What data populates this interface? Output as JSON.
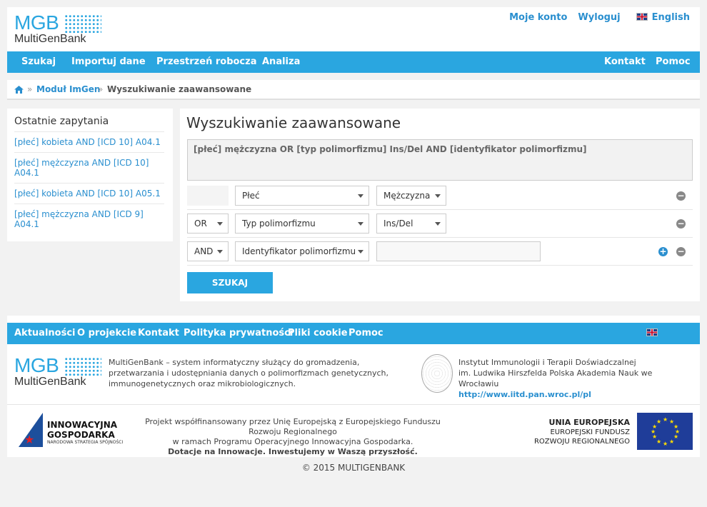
{
  "header": {
    "logo_short": "MGB",
    "logo_full": "MultiGenBank",
    "links": [
      "Moje konto",
      "Wyloguj"
    ],
    "language": "English"
  },
  "nav": {
    "left": [
      "Szukaj",
      "Importuj dane",
      "Przestrzeń robocza",
      "Analiza"
    ],
    "right": [
      "Kontakt",
      "Pomoc"
    ]
  },
  "breadcrumb": {
    "sep": "»",
    "items": [
      "Moduł ImGen",
      "Wyszukiwanie zaawansowane"
    ]
  },
  "sidebar": {
    "title": "Ostatnie zapytania",
    "items": [
      "[płeć] kobieta AND [ICD 10] A04.1",
      "[płeć] mężczyzna AND [ICD 10] A04.1",
      "[płeć] kobieta AND [ICD 10] A05.1",
      "[płeć] mężczyzna AND [ICD 9] A04.1"
    ]
  },
  "search": {
    "title": "Wyszukiwanie zaawansowane",
    "query": "[płeć] mężczyzna OR [typ polimorfizmu] Ins/Del AND [identyfikator polimorfizmu]",
    "rows": [
      {
        "op": "",
        "field": "Płeć",
        "value": "Mężczyzna"
      },
      {
        "op": "OR",
        "field": "Typ polimorfizmu",
        "value": "Ins/Del"
      },
      {
        "op": "AND",
        "field": "Identyfikator polimorfizmu",
        "value": ""
      }
    ],
    "button": "SZUKAJ",
    "minus": "−",
    "plus": "+"
  },
  "footer": {
    "nav": [
      "Aktualności",
      "O projekcie",
      "Kontakt",
      "Polityka prywatności",
      "Pliki cookie",
      "Pomoc"
    ],
    "language": "English",
    "desc": "MultiGenBank – system informatyczny służący do gromadzenia, przetwarzania i udostępniania danych o polimorfizmach genetycznych, immunogenetycznych oraz mikrobiologicznych.",
    "inst_line1": "Instytut Immunologii i Terapii Doświadczalnej",
    "inst_line2": "im. Ludwika Hirszfelda Polska Akademia Nauk we Wrocławiu",
    "inst_url": "http://www.iitd.pan.wroc.pl/pl",
    "ig_line1": "INNOWACYJNA",
    "ig_line2": "GOSPODARKA",
    "ig_line3": "NARODOWA STRATEGIA SPÓJNOŚCI",
    "proj_line1": "Projekt współfinansowany przez Unię Europejską z Europejskiego Funduszu Rozwoju Regionalnego",
    "proj_line2": "w ramach Programu Operacyjnego Innowacyjna Gospodarka.",
    "proj_line3": "Dotacje na Innowacje. Inwestujemy w Waszą przyszłość.",
    "ue_line1": "UNIA EUROPEJSKA",
    "ue_line2": "EUROPEJSKI FUNDUSZ",
    "ue_line3": "ROZWOJU REGIONALNEGO",
    "copyright": "© 2015 MULTIGENBANK"
  }
}
